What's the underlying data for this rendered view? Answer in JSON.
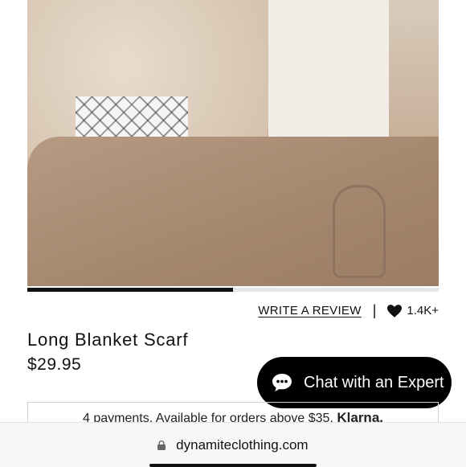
{
  "product": {
    "name": "Long Blanket Scarf",
    "price": "$29.95",
    "image_progress": 0.5
  },
  "actions": {
    "review_label": "WRITE A REVIEW",
    "separator": "|",
    "likes_count": "1.4K+"
  },
  "chat": {
    "label": "Chat with an Expert"
  },
  "klarna": {
    "text": "4 payments. Available for orders above $35.",
    "brand": "Klarna."
  },
  "browser": {
    "url": "dynamiteclothing.com"
  },
  "colors": {
    "accent": "#000000",
    "background": "#ffffff"
  },
  "icons": {
    "heart": "heart-icon",
    "chat": "chat-bubble-icon",
    "lock": "lock-icon"
  }
}
